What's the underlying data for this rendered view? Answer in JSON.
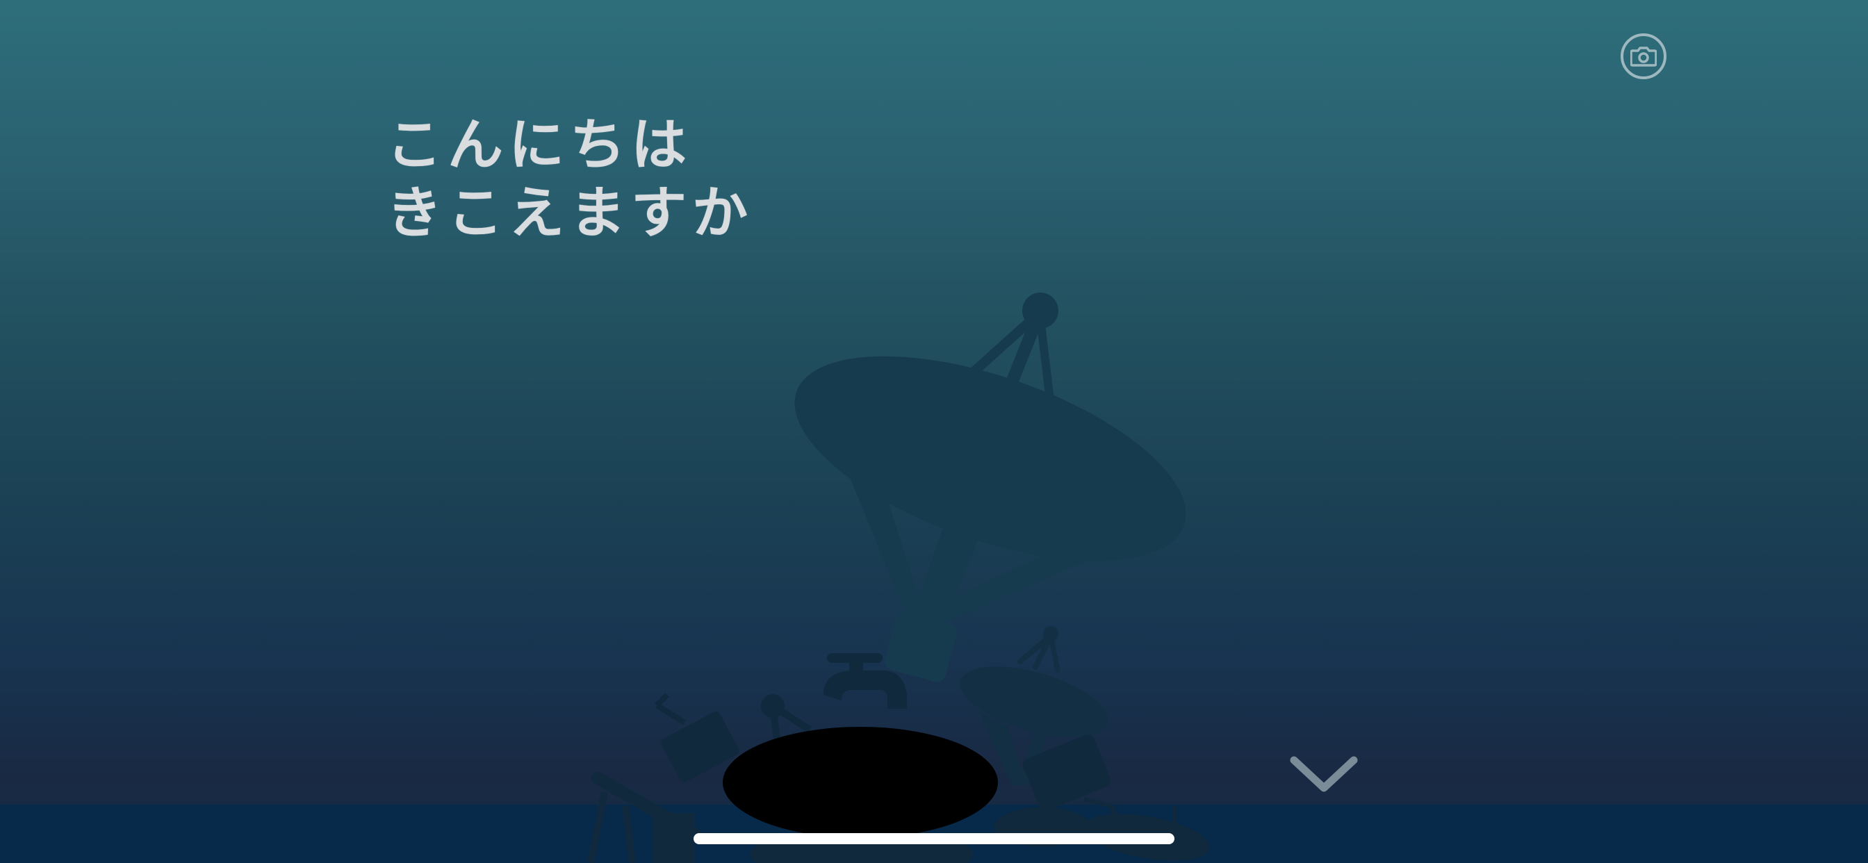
{
  "message": {
    "line1": "こんにちは",
    "line2": "きこえますか"
  },
  "controls": {
    "camera_icon": "camera-icon",
    "down_icon": "chevron-down-icon"
  },
  "colors": {
    "sky_top": "#2e6e7b",
    "sky_bottom": "#192943",
    "ground": "#07294a",
    "silhouette": "#173b4e",
    "text": "#d9dde0"
  }
}
